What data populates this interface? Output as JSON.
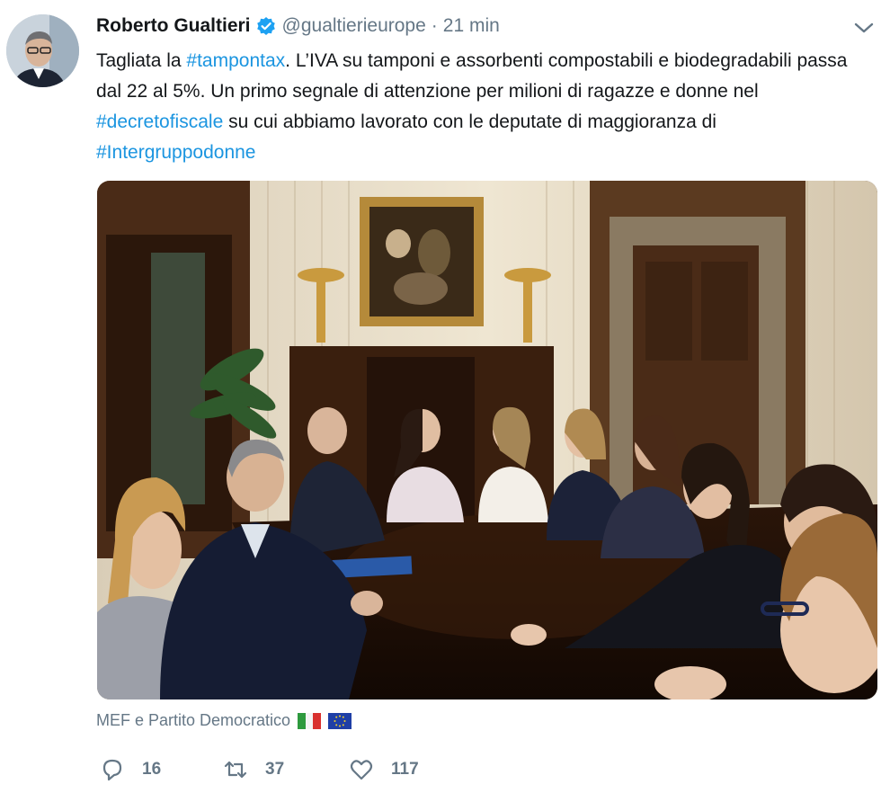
{
  "tweet": {
    "author_name": "Roberto Gualtieri",
    "handle": "@gualtierieurope",
    "separator": "·",
    "time": "21 min",
    "text": {
      "p1": "Tagliata la ",
      "tag1": "#tampontax",
      "p2": ". L’IVA su tamponi e assorbenti compostabili e biodegradabili passa dal 22 al 5%. Un primo segnale di attenzione per milioni di ragazze e donne nel ",
      "tag2": "#decretofiscale",
      "p3": " su cui abbiamo lavorato con le deputate di maggioranza di ",
      "tag3": "#Intergruppodonne"
    },
    "tagged": "MEF e Partito Democratico",
    "replies": "16",
    "retweets": "37",
    "likes": "117"
  },
  "icons": {
    "verified": "verified-badge-icon",
    "caret": "chevron-down-icon",
    "reply": "reply-icon",
    "retweet": "retweet-icon",
    "like": "heart-icon",
    "flag_it": "italy-flag-icon",
    "flag_eu": "eu-flag-icon"
  },
  "colors": {
    "link": "#1b95e0",
    "muted": "#657786",
    "verified": "#1da1f2",
    "text": "#14171a"
  }
}
